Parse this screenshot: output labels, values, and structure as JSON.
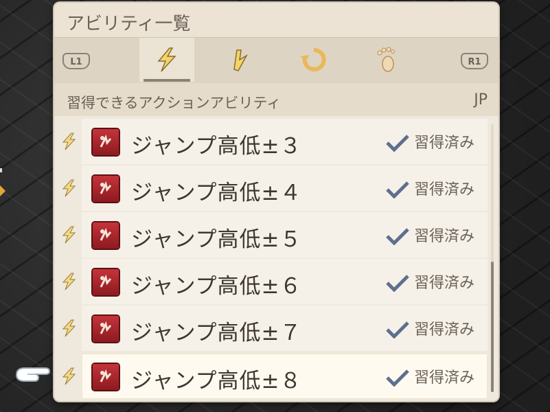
{
  "window": {
    "title": "アビリティ一覧"
  },
  "tabs": {
    "left_button": "L1",
    "right_button": "R1",
    "items": [
      {
        "icon": "lightning-bolt-icon",
        "active": true
      },
      {
        "icon": "slanted-bolt-icon",
        "active": false
      },
      {
        "icon": "circular-arrow-icon",
        "active": false
      },
      {
        "icon": "footprint-icon",
        "active": false
      }
    ]
  },
  "section": {
    "title": "習得できるアクションアビリティ",
    "jp_label": "JP"
  },
  "abilities": [
    {
      "name": "ジャンプ高低±３",
      "status": "習得済み"
    },
    {
      "name": "ジャンプ高低±４",
      "status": "習得済み"
    },
    {
      "name": "ジャンプ高低±５",
      "status": "習得済み"
    },
    {
      "name": "ジャンプ高低±６",
      "status": "習得済み"
    },
    {
      "name": "ジャンプ高低±７",
      "status": "習得済み"
    },
    {
      "name": "ジャンプ高低±８",
      "status": "習得済み"
    }
  ],
  "selected_index": 5,
  "colors": {
    "panel": "#efe8dc",
    "text": "#3e3630",
    "accent": "#8a8177",
    "ability_icon": "#b3282e",
    "bolt": "#e3b24a",
    "check": "#5e6f8f"
  }
}
